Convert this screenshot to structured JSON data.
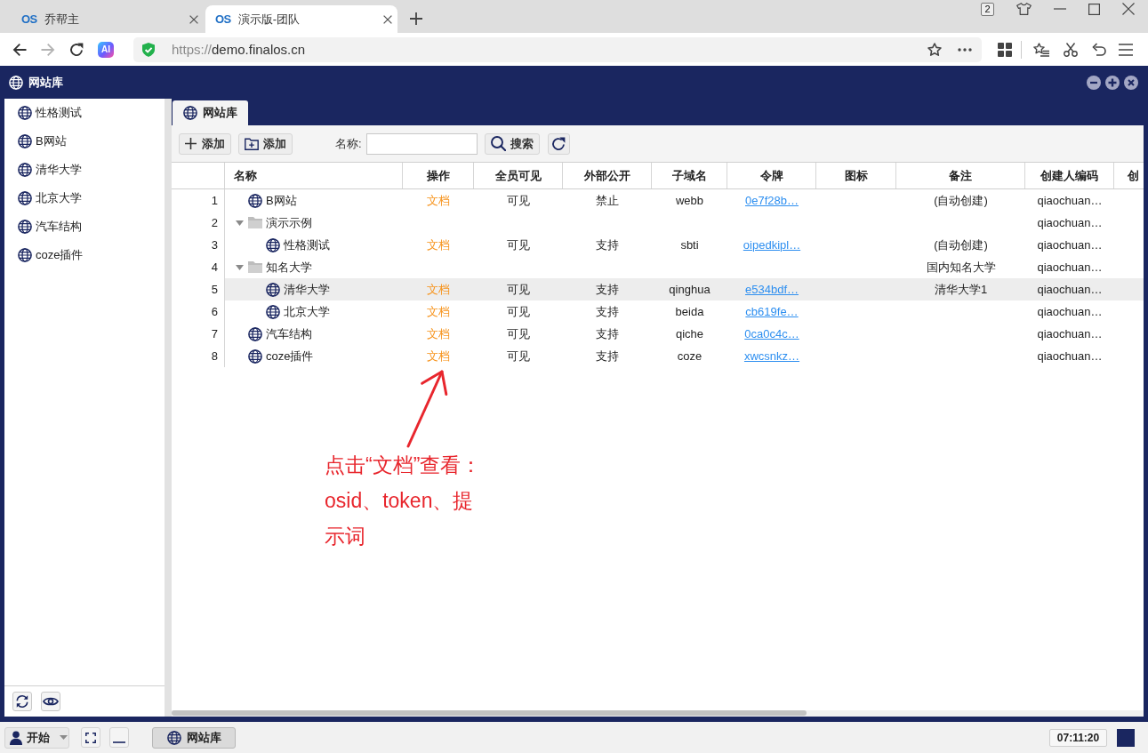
{
  "browser": {
    "tabs": [
      {
        "favicon": "OS",
        "title": "乔帮主",
        "selected": false
      },
      {
        "favicon": "OS",
        "title": "演示版-团队",
        "selected": true
      }
    ],
    "tab_count": "2",
    "nav_buttons": [
      {
        "kind": "back",
        "disabled": false
      },
      {
        "kind": "forward",
        "disabled": true
      },
      {
        "kind": "reload",
        "disabled": false
      }
    ],
    "ai_badge": "AI",
    "address": {
      "scheme": "https://",
      "host": "demo.finalos.cn"
    }
  },
  "window": {
    "title": "网站库"
  },
  "sidebar": {
    "items": [
      {
        "label": "性格测试",
        "selected": false
      },
      {
        "label": "B网站",
        "selected": false
      },
      {
        "label": "清华大学",
        "selected": false
      },
      {
        "label": "北京大学",
        "selected": false
      },
      {
        "label": "汽车结构",
        "selected": false
      },
      {
        "label": "coze插件",
        "selected": false
      }
    ]
  },
  "main": {
    "tabs": [
      {
        "label": "网站库",
        "selected": true
      }
    ],
    "toolbar": [
      {
        "kind": "add",
        "label": "添加"
      },
      {
        "kind": "add_folder",
        "label": "添加"
      },
      {
        "kind": "field",
        "label": "名称:"
      },
      {
        "kind": "search",
        "label": "搜索"
      },
      {
        "kind": "refresh"
      }
    ],
    "table": {
      "columns": [
        "名称",
        "操作",
        "全员可见",
        "外部公开",
        "子域名",
        "令牌",
        "图标",
        "备注",
        "创建人编码",
        "创"
      ],
      "rows": [
        {
          "number": "1",
          "kind": "site",
          "name": "B网站",
          "action": "文档",
          "visibility": "可见",
          "public": "禁止",
          "subdomain": "webb",
          "token": "0e7f28b…",
          "note": "(自动创建)",
          "creator": "qiaochuan…",
          "selected": false
        },
        {
          "number": "2",
          "kind": "folder",
          "name": "演示示例",
          "expanded": true,
          "creator": "qiaochuan…",
          "selected": false,
          "children": [
            {
              "number": "3",
              "kind": "site",
              "name": "性格测试",
              "action": "文档",
              "visibility": "可见",
              "public": "支持",
              "subdomain": "sbti",
              "token": "oipedkipl…",
              "note": "(自动创建)",
              "creator": "qiaochuan…",
              "selected": false
            }
          ]
        },
        {
          "number": "4",
          "kind": "folder",
          "name": "知名大学",
          "expanded": true,
          "note": "国内知名大学",
          "creator": "qiaochuan…",
          "selected": false,
          "children": [
            {
              "number": "5",
              "kind": "site",
              "name": "清华大学",
              "action": "文档",
              "visibility": "可见",
              "public": "支持",
              "subdomain": "qinghua",
              "token": "e534bdf…",
              "note": "清华大学1",
              "creator": "qiaochuan…",
              "selected": true
            },
            {
              "number": "6",
              "kind": "site",
              "name": "北京大学",
              "action": "文档",
              "visibility": "可见",
              "public": "支持",
              "subdomain": "beida",
              "token": "cb619fe…",
              "creator": "qiaochuan…",
              "selected": false
            }
          ]
        },
        {
          "number": "7",
          "kind": "site",
          "name": "汽车结构",
          "action": "文档",
          "visibility": "可见",
          "public": "支持",
          "subdomain": "qiche",
          "token": "0ca0c4c…",
          "creator": "qiaochuan…",
          "selected": false
        },
        {
          "number": "8",
          "kind": "site",
          "name": "coze插件",
          "action": "文档",
          "visibility": "可见",
          "public": "支持",
          "subdomain": "coze",
          "token": "xwcsnkz…",
          "creator": "qiaochuan…",
          "selected": false
        }
      ]
    }
  },
  "annotation": {
    "lines": [
      "点击“文档”查看：",
      "osid、token、提",
      "示词"
    ]
  },
  "taskbar": {
    "start_label": "开始",
    "tasks": [
      {
        "label": "网站库",
        "selected": true
      }
    ],
    "clock": "07:11:20"
  }
}
